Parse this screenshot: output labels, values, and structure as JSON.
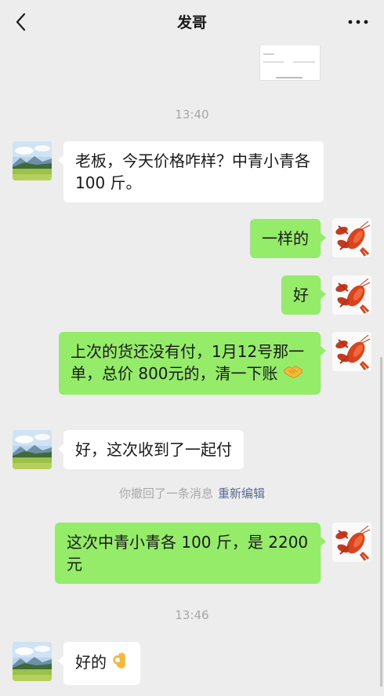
{
  "header": {
    "title": "发哥",
    "back_icon": "chevron-left-icon",
    "more_icon": "more-dots-icon"
  },
  "timestamps": [
    "13:40",
    "13:46"
  ],
  "messages": [
    {
      "side": "left",
      "text": "老板，今天价格咋样？中青小青各 100 斤。"
    },
    {
      "side": "right",
      "text": "一样的"
    },
    {
      "side": "right",
      "text": "好"
    },
    {
      "side": "right",
      "text": "上次的货还没有付，1月12号那一单，总价 800元的，清一下账",
      "emoji": "handshake-emoji"
    },
    {
      "side": "left",
      "text": "好，这次收到了一起付"
    },
    {
      "side": "right",
      "text": "这次中青小青各 100 斤，是 2200 元"
    },
    {
      "side": "left",
      "text": "好的",
      "emoji": "ok-hand-emoji"
    }
  ],
  "recall": {
    "text": "你撤回了一条消息",
    "edit_label": "重新编辑"
  },
  "colors": {
    "background": "#ededed",
    "bubble_self": "#95ec69",
    "bubble_other": "#ffffff",
    "timestamp": "#a8a8a8",
    "link": "#576b95"
  }
}
